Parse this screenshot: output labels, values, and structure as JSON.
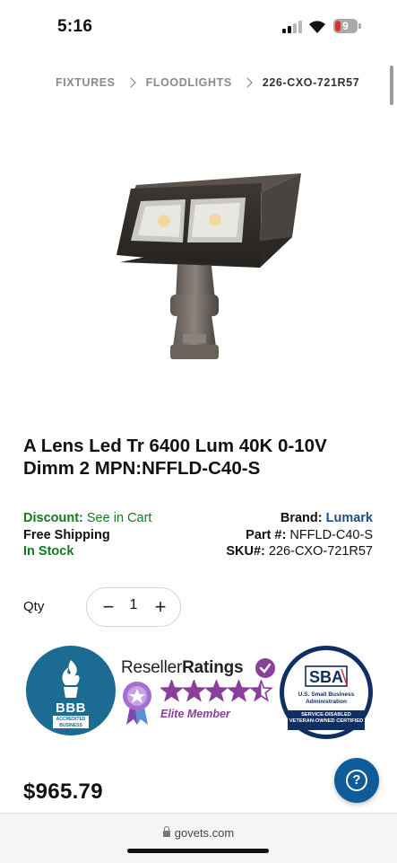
{
  "status": {
    "time": "5:16",
    "battery": "9"
  },
  "breadcrumb": [
    {
      "label": "FIXTURES"
    },
    {
      "label": "FLOODLIGHTS"
    },
    {
      "label": "226-CXO-721R57"
    }
  ],
  "product": {
    "title": "A Lens Led Tr 6400 Lum 40K 0-10V Dimm 2 MPN:NFFLD-C40-S",
    "discount_label": "Discount:",
    "discount_value": "See in Cart",
    "shipping": "Free Shipping",
    "stock": "In Stock",
    "brand_label": "Brand:",
    "brand_value": "Lumark",
    "part_label": "Part #:",
    "part_value": "NFFLD-C40-S",
    "sku_label": "SKU#:",
    "sku_value": "226-CXO-721R57",
    "price": "$965.79"
  },
  "quantity": {
    "label": "Qty",
    "value": "1",
    "minus": "−",
    "plus": "+"
  },
  "badges": {
    "bbb_text": "BBB",
    "bbb_accredited": "ACCREDITED BUSINESS",
    "reseller_prefix": "Reseller",
    "reseller_bold": "Ratings",
    "reseller_tier": "Elite Member",
    "reseller_rating": 4.5,
    "sba_word": "SBA",
    "sba_line": "U.S. Small Business Administration",
    "sba_band": "SERVICE-DISABLED VETERAN-OWNED CERTIFIED"
  },
  "help": {
    "glyph": "?"
  },
  "browser": {
    "url": "govets.com"
  },
  "colors": {
    "green": "#157a1c",
    "brand_blue": "#1f4f86",
    "bbb_blue": "#1b6b93",
    "rr_purple": "#8a3f9c",
    "sba_navy": "#0f2f63",
    "help_blue": "#0f5c9a"
  }
}
